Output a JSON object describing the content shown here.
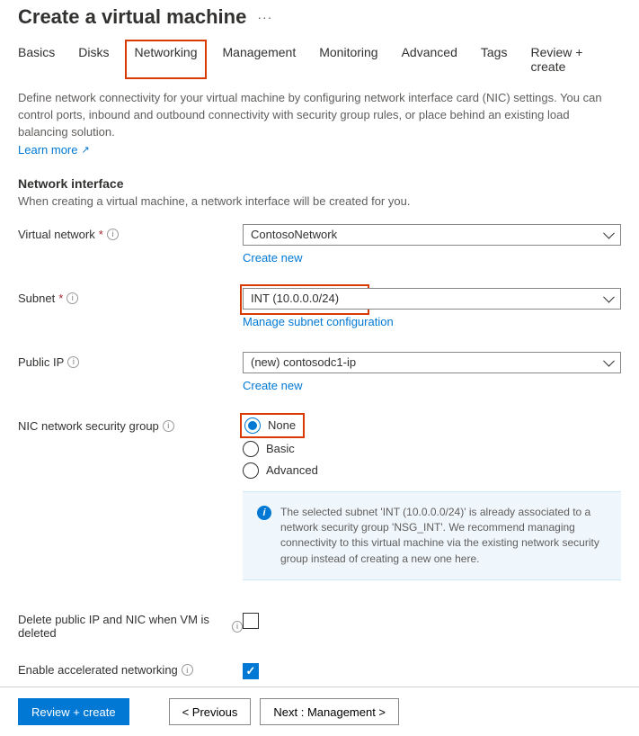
{
  "header": {
    "title": "Create a virtual machine"
  },
  "tabs": [
    {
      "label": "Basics"
    },
    {
      "label": "Disks"
    },
    {
      "label": "Networking",
      "active": true
    },
    {
      "label": "Management"
    },
    {
      "label": "Monitoring"
    },
    {
      "label": "Advanced"
    },
    {
      "label": "Tags"
    },
    {
      "label": "Review + create"
    }
  ],
  "intro": {
    "text": "Define network connectivity for your virtual machine by configuring network interface card (NIC) settings. You can control ports, inbound and outbound connectivity with security group rules, or place behind an existing load balancing solution.",
    "learn_more": "Learn more"
  },
  "section": {
    "title": "Network interface",
    "desc": "When creating a virtual machine, a network interface will be created for you."
  },
  "fields": {
    "vnet": {
      "label": "Virtual network",
      "required": true,
      "value": "ContosoNetwork",
      "sublink": "Create new"
    },
    "subnet": {
      "label": "Subnet",
      "required": true,
      "value": "INT (10.0.0.0/24)",
      "sublink": "Manage subnet configuration"
    },
    "publicip": {
      "label": "Public IP",
      "required": false,
      "value": "(new) contosodc1-ip",
      "sublink": "Create new"
    },
    "nsg": {
      "label": "NIC network security group",
      "options": [
        "None",
        "Basic",
        "Advanced"
      ],
      "selected": "None"
    },
    "delete_nic": {
      "label": "Delete public IP and NIC when VM is deleted",
      "checked": false
    },
    "accel_net": {
      "label": "Enable accelerated networking",
      "checked": true
    }
  },
  "info_box": "The selected subnet 'INT (10.0.0.0/24)' is already associated to a network security group 'NSG_INT'. We recommend managing connectivity to this virtual machine via the existing network security group instead of creating a new one here.",
  "footer": {
    "review": "Review + create",
    "prev": "< Previous",
    "next": "Next : Management >"
  }
}
